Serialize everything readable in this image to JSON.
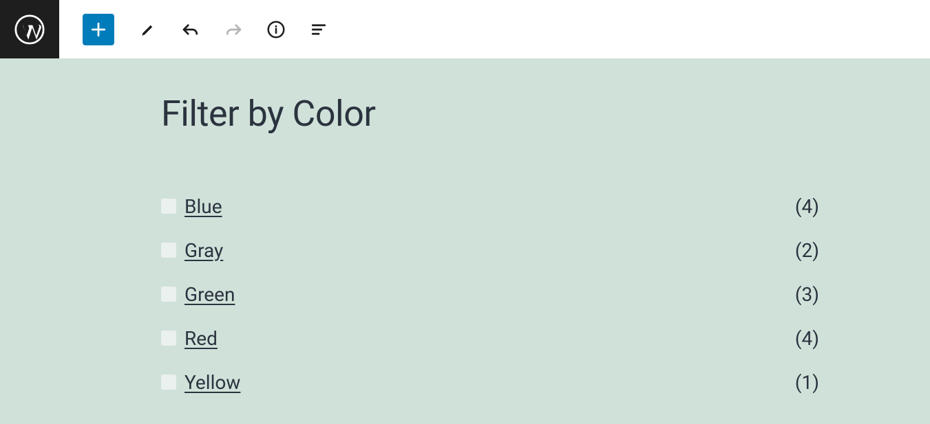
{
  "heading": "Filter by Color",
  "filters": [
    {
      "label": "Blue",
      "count": "(4)"
    },
    {
      "label": "Gray",
      "count": "(2)"
    },
    {
      "label": "Green",
      "count": "(3)"
    },
    {
      "label": "Red",
      "count": "(4)"
    },
    {
      "label": "Yellow",
      "count": "(1)"
    }
  ]
}
